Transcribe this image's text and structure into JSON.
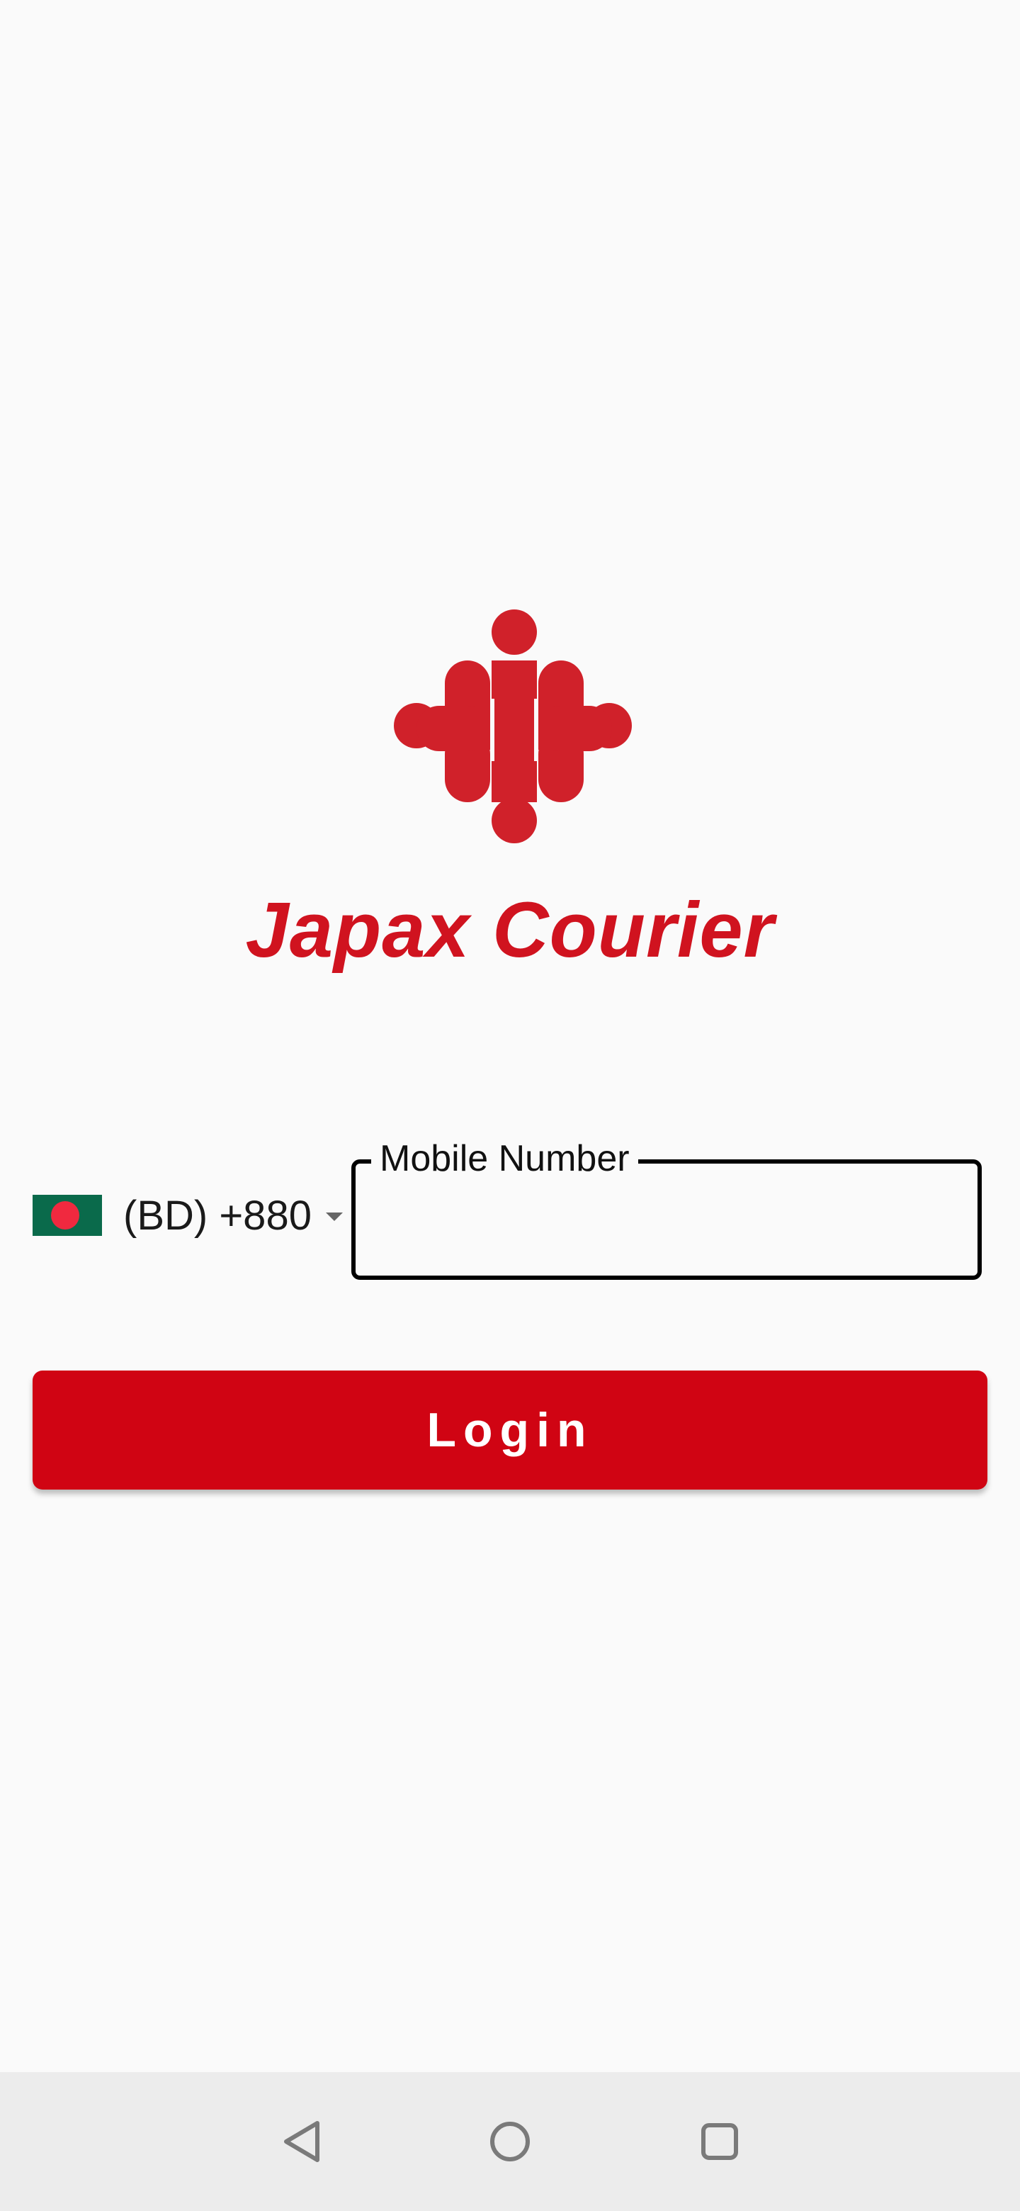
{
  "app": {
    "brand_name": "Japax Courier",
    "brand_color": "#d0131f"
  },
  "login_form": {
    "country": {
      "flag_icon": "bangladesh-flag-icon",
      "code_label": "(BD) +880",
      "dropdown_icon": "caret-down-icon"
    },
    "mobile_field": {
      "label": "Mobile Number",
      "value": "",
      "placeholder": ""
    },
    "login_button": {
      "label": "Login",
      "color": "#d00413"
    }
  },
  "system_nav": {
    "back_icon": "triangle-back-icon",
    "home_icon": "circle-home-icon",
    "recents_icon": "square-recents-icon"
  }
}
